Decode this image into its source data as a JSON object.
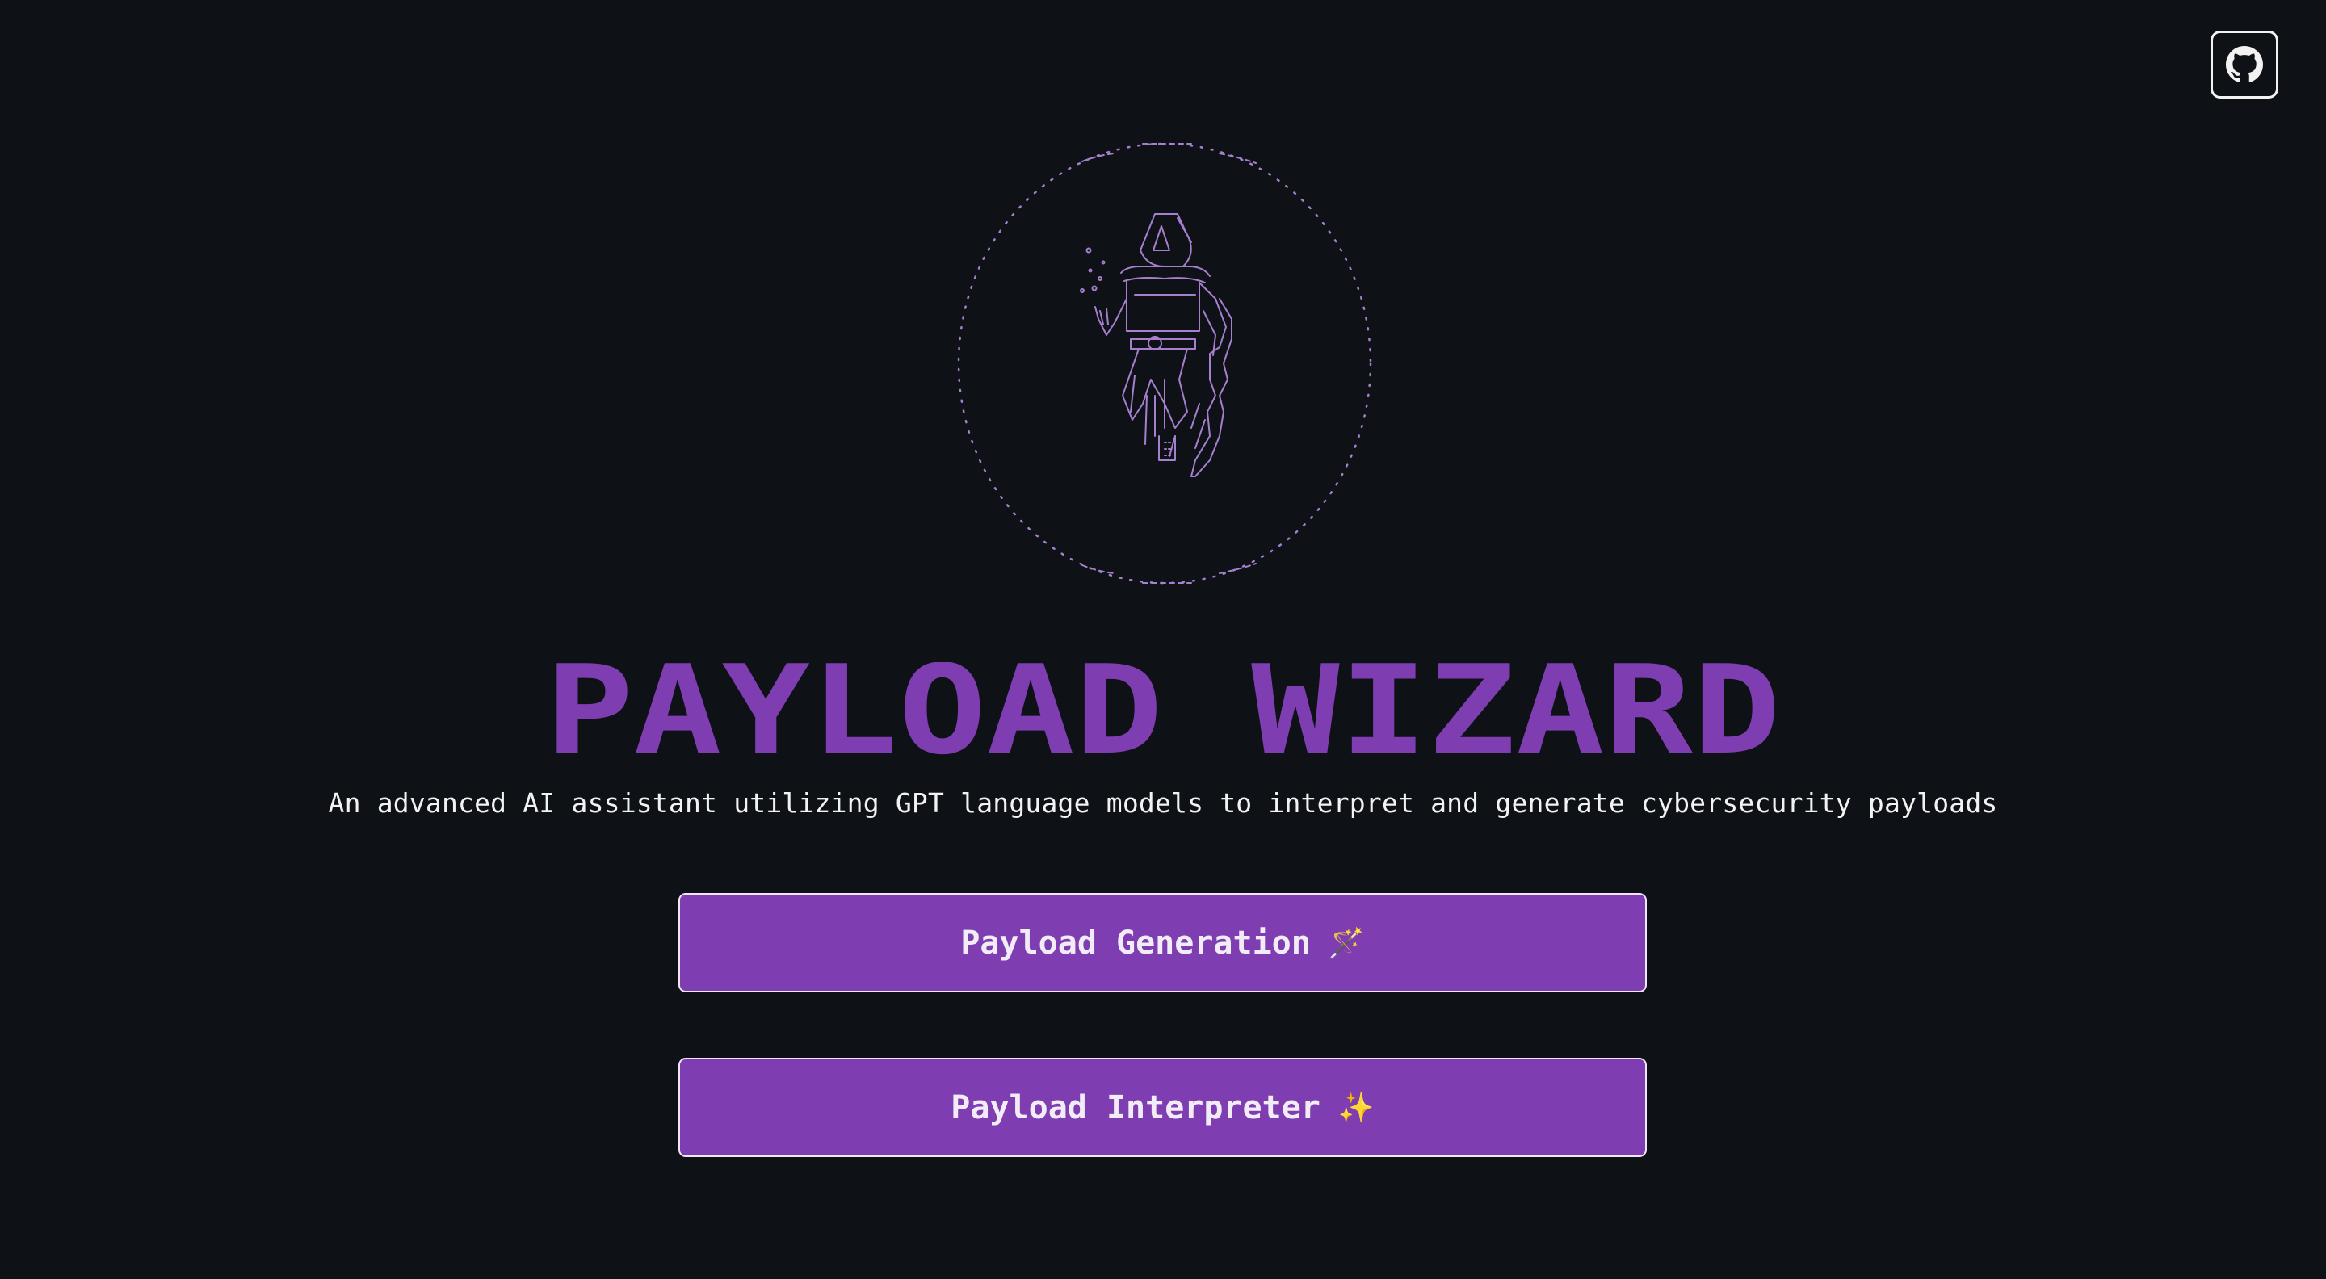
{
  "header": {
    "github_icon": "github-icon"
  },
  "hero": {
    "art_icon": "ascii-wizard-illustration",
    "accent_color": "#7e3db0",
    "art_color": "#a77fcf"
  },
  "title": "PAYLOAD WIZARD",
  "subtitle": "An advanced AI assistant utilizing GPT language models to interpret and generate cybersecurity payloads",
  "buttons": {
    "generation": {
      "label": "Payload Generation",
      "emoji": "🪄"
    },
    "interpreter": {
      "label": "Payload Interpreter",
      "emoji": "✨"
    }
  }
}
